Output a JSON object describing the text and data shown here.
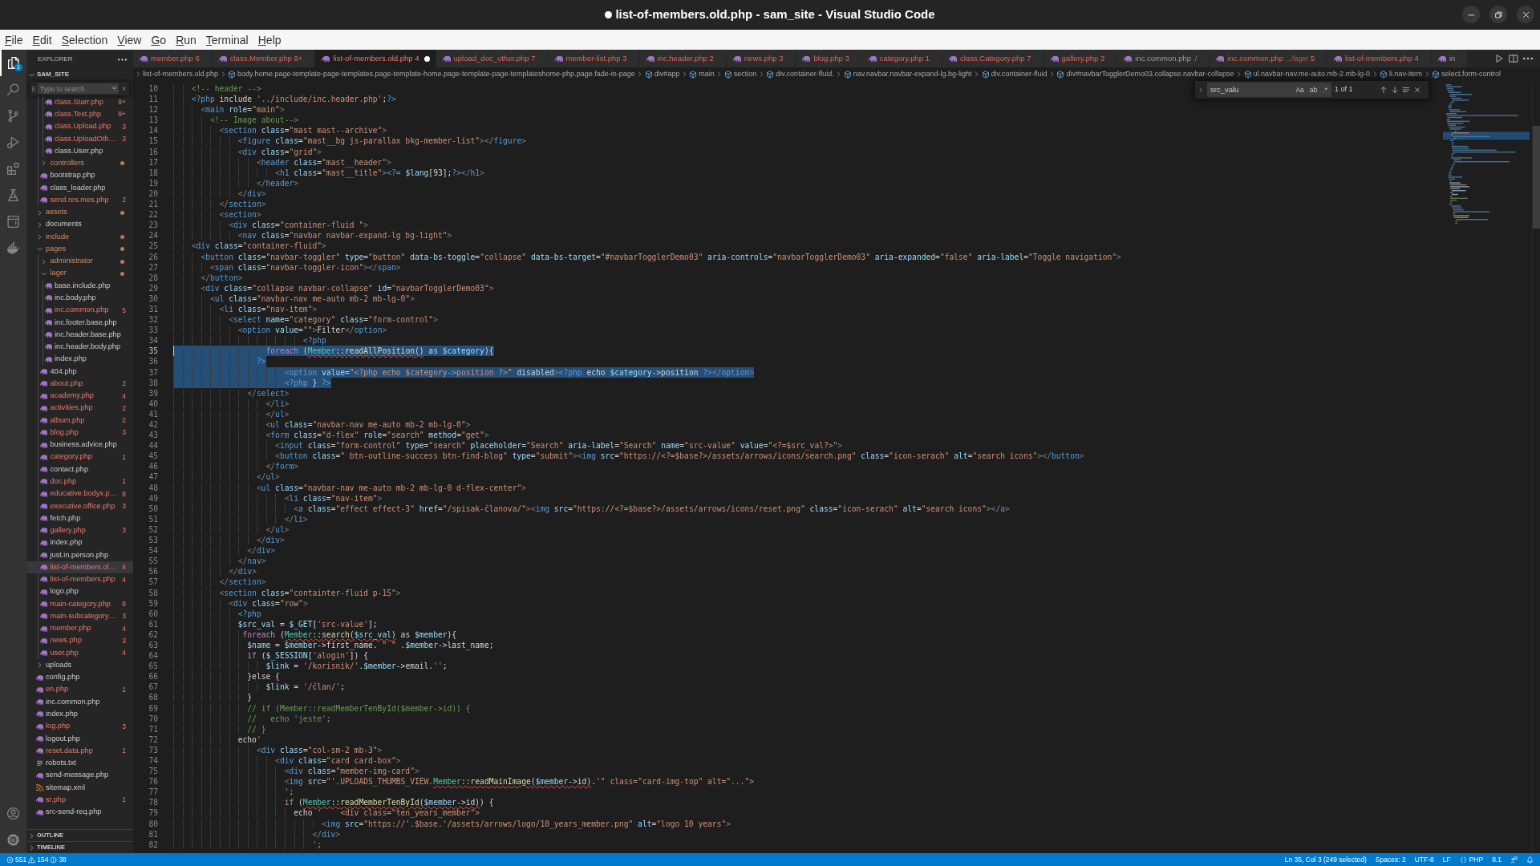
{
  "window": {
    "title": "list-of-members.old.php - sam_site - Visual Studio Code",
    "modified": true
  },
  "menu": [
    "File",
    "Edit",
    "Selection",
    "View",
    "Go",
    "Run",
    "Terminal",
    "Help"
  ],
  "activity_bar": {
    "items": [
      {
        "kind": "explorer",
        "selected": true,
        "badge": "1"
      },
      {
        "kind": "search",
        "selected": false
      },
      {
        "kind": "source-control",
        "selected": false
      },
      {
        "kind": "run-debug",
        "selected": false
      },
      {
        "kind": "extensions",
        "selected": false
      },
      {
        "kind": "testing",
        "selected": false
      },
      {
        "kind": "remote",
        "selected": false
      },
      {
        "kind": "docker",
        "selected": false
      }
    ],
    "bottom": [
      {
        "kind": "account"
      },
      {
        "kind": "settings"
      }
    ]
  },
  "sidebar": {
    "title": "EXPLORER",
    "section": {
      "title": "SAM_SITE",
      "expanded": true
    },
    "filter": {
      "placeholder": "Type to search"
    },
    "tree": [
      {
        "children": [
          {
            "children": [
              {
                "label": "class.Starr.php",
                "kind": "php",
                "error": true,
                "problems": "9+",
                "selected": false
              },
              {
                "label": "class.Text.php",
                "kind": "php",
                "error": true,
                "problems": "9+",
                "selected": false
              },
              {
                "label": "class.Upload.php",
                "kind": "php",
                "error": true,
                "problems": "3",
                "selected": false
              },
              {
                "label": "class.UploadOth…",
                "kind": "php",
                "error": true,
                "problems": "3",
                "selected": false
              },
              {
                "label": "class.User.php",
                "kind": "php",
                "error": false,
                "selected": false
              }
            ]
          },
          {
            "label": "controllers",
            "kind": "folder",
            "expanded": false,
            "error": true,
            "selected": false
          },
          {
            "label": "bootstrap.php",
            "kind": "php",
            "error": false,
            "selected": false
          },
          {
            "label": "class_loader.php",
            "kind": "php",
            "error": false,
            "selected": false
          },
          {
            "label": "send.res.mes.php",
            "kind": "php",
            "error": true,
            "problems": "2",
            "selected": false
          }
        ]
      },
      {
        "label": "assets",
        "kind": "folder",
        "expanded": false,
        "error": true,
        "selected": false
      },
      {
        "label": "documents",
        "kind": "folder",
        "expanded": false,
        "error": false,
        "selected": false
      },
      {
        "label": "include",
        "kind": "folder",
        "expanded": false,
        "error": true,
        "selected": false
      },
      {
        "label": "pages",
        "kind": "folder",
        "expanded": true,
        "error": true,
        "selected": false,
        "children": [
          {
            "label": "administrator",
            "kind": "folder",
            "expanded": false,
            "error": true,
            "selected": false
          },
          {
            "label": "lager",
            "kind": "folder",
            "expanded": true,
            "error": true,
            "selected": false,
            "children": [
              {
                "label": "base.include.php",
                "kind": "php",
                "error": false,
                "selected": false
              },
              {
                "label": "inc.body.php",
                "kind": "php",
                "error": false,
                "selected": false
              },
              {
                "label": "inc.common.php",
                "kind": "php",
                "error": true,
                "problems": "5",
                "selected": false
              },
              {
                "label": "inc.footer.base.php",
                "kind": "php",
                "error": false,
                "selected": false
              },
              {
                "label": "inc.header.base.php",
                "kind": "php",
                "error": false,
                "selected": false
              },
              {
                "label": "inc.header.body.php",
                "kind": "php",
                "error": false,
                "selected": false
              },
              {
                "label": "index.php",
                "kind": "php",
                "error": false,
                "selected": false
              }
            ]
          },
          {
            "label": "404.php",
            "kind": "php",
            "error": false,
            "selected": false
          },
          {
            "label": "about.php",
            "kind": "php",
            "error": true,
            "problems": "2",
            "selected": false
          },
          {
            "label": "academy.php",
            "kind": "php",
            "error": true,
            "problems": "4",
            "selected": false
          },
          {
            "label": "activities.php",
            "kind": "php",
            "error": true,
            "problems": "2",
            "selected": false
          },
          {
            "label": "album.php",
            "kind": "php",
            "error": true,
            "problems": "2",
            "selected": false
          },
          {
            "label": "blog.php",
            "kind": "php",
            "error": true,
            "problems": "3",
            "selected": false
          },
          {
            "label": "business.advice.php",
            "kind": "php",
            "error": false,
            "selected": false
          },
          {
            "label": "category.php",
            "kind": "php",
            "error": true,
            "problems": "1",
            "selected": false
          },
          {
            "label": "contact.php",
            "kind": "php",
            "error": false,
            "selected": false
          },
          {
            "label": "doc.php",
            "kind": "php",
            "error": true,
            "problems": "1",
            "selected": false
          },
          {
            "label": "educative.bodys.p…",
            "kind": "php",
            "error": true,
            "problems": "8",
            "selected": false
          },
          {
            "label": "executive.office.php",
            "kind": "php",
            "error": true,
            "problems": "3",
            "selected": false
          },
          {
            "label": "fetch.php",
            "kind": "php",
            "error": false,
            "selected": false
          },
          {
            "label": "gallery.php",
            "kind": "php",
            "error": true,
            "problems": "3",
            "selected": false
          },
          {
            "label": "index.php",
            "kind": "php",
            "error": false,
            "selected": false
          },
          {
            "label": "just.in.person.php",
            "kind": "php",
            "error": false,
            "selected": false
          },
          {
            "label": "list-of-members.ol…",
            "kind": "php",
            "error": true,
            "problems": "4",
            "selected": true
          },
          {
            "label": "list-of-members.php",
            "kind": "php",
            "error": true,
            "problems": "4",
            "selected": false
          },
          {
            "label": "logo.php",
            "kind": "php",
            "error": false,
            "selected": false
          },
          {
            "label": "main-category.php",
            "kind": "php",
            "error": true,
            "problems": "8",
            "selected": false
          },
          {
            "label": "main-subcategory…",
            "kind": "php",
            "error": true,
            "problems": "3",
            "selected": false
          },
          {
            "label": "member.php",
            "kind": "php",
            "error": true,
            "problems": "4",
            "selected": false
          },
          {
            "label": "news.php",
            "kind": "php",
            "error": true,
            "problems": "3",
            "selected": false
          },
          {
            "label": "user.php",
            "kind": "php",
            "error": true,
            "problems": "4",
            "selected": false
          }
        ]
      },
      {
        "label": "uploads",
        "kind": "folder",
        "expanded": false,
        "error": false,
        "selected": false
      },
      {
        "label": "config.php",
        "kind": "php",
        "error": false,
        "selected": false
      },
      {
        "label": "en.php",
        "kind": "php",
        "error": true,
        "problems": "1",
        "selected": false
      },
      {
        "label": "inc.common.php",
        "kind": "php",
        "error": false,
        "selected": false
      },
      {
        "label": "index.php",
        "kind": "php",
        "error": false,
        "selected": false
      },
      {
        "label": "log.php",
        "kind": "php",
        "error": true,
        "problems": "3",
        "selected": false
      },
      {
        "label": "logout.php",
        "kind": "php",
        "error": false,
        "selected": false
      },
      {
        "label": "reset.data.php",
        "kind": "php",
        "error": true,
        "problems": "1",
        "selected": false
      },
      {
        "label": "robots.txt",
        "kind": "txt",
        "error": false,
        "selected": false
      },
      {
        "label": "send-message.php",
        "kind": "php",
        "error": false,
        "selected": false
      },
      {
        "label": "sitemap.xml",
        "kind": "xml",
        "error": false,
        "selected": false
      },
      {
        "label": "sr.php",
        "kind": "php",
        "error": true,
        "problems": "1",
        "selected": false
      },
      {
        "label": "src-send-req.php",
        "kind": "php",
        "error": false,
        "selected": false
      }
    ],
    "panels": [
      {
        "title": "OUTLINE",
        "expanded": false
      },
      {
        "title": "TIMELINE",
        "expanded": false
      }
    ]
  },
  "editor": {
    "tabs": [
      {
        "label": "member.php",
        "problems": "6",
        "error": true,
        "selected": false,
        "modified": false
      },
      {
        "label": "class.Member.php",
        "problems": "9+",
        "error": true,
        "selected": false,
        "modified": false
      },
      {
        "label": "list-of-members.old.php",
        "problems": "4",
        "error": true,
        "selected": true,
        "modified": true
      },
      {
        "label": "upload_doc_other.php",
        "problems": "7",
        "error": true,
        "selected": false,
        "modified": false
      },
      {
        "label": "member-list.php",
        "problems": "3",
        "error": true,
        "selected": false,
        "modified": false
      },
      {
        "label": "inc.header.php",
        "problems": "2",
        "error": true,
        "selected": false,
        "modified": false
      },
      {
        "label": "news.php",
        "problems": "3",
        "error": true,
        "selected": false,
        "modified": false
      },
      {
        "label": "blog.php",
        "problems": "3",
        "error": true,
        "selected": false,
        "modified": false
      },
      {
        "label": "category.php",
        "problems": "1",
        "error": true,
        "selected": false,
        "modified": false
      },
      {
        "label": "class.Category.php",
        "problems": "7",
        "error": true,
        "selected": false,
        "modified": false
      },
      {
        "label": "gallery.php",
        "problems": "3",
        "error": true,
        "selected": false,
        "modified": false
      },
      {
        "label": "inc.common.php",
        "description": "./",
        "error": false,
        "selected": false,
        "modified": false
      },
      {
        "label": "inc.common.php",
        "description": ".../lager",
        "problems": "5",
        "error": true,
        "selected": false,
        "modified": false
      },
      {
        "label": "list-of-members.php",
        "problems": "4",
        "error": true,
        "selected": false,
        "modified": false
      },
      {
        "label": "in",
        "error": false,
        "selected": false,
        "modified": false
      }
    ],
    "breadcrumbs": [
      {
        "label": "list-of-members.old.php",
        "kind": "file"
      },
      {
        "label": "body.home.page-template-page-templates.page-template-home.page-template-page-templateshome-php.page.fade-in-page",
        "kind": "symbol"
      },
      {
        "label": "div#app",
        "kind": "symbol"
      },
      {
        "label": "main",
        "kind": "symbol"
      },
      {
        "label": "section",
        "kind": "symbol"
      },
      {
        "label": "div.container-fluid.",
        "kind": "symbol"
      },
      {
        "label": "nav.navbar.navbar-expand-lg.bg-light",
        "kind": "symbol"
      },
      {
        "label": "div.container-fluid",
        "kind": "symbol"
      },
      {
        "label": "div#navbarTogglerDemo03.collapse.navbar-collapse",
        "kind": "symbol"
      },
      {
        "label": "ul.navbar-nav.me-auto.mb-2.mb-lg-0",
        "kind": "symbol"
      },
      {
        "label": "li.nav-item",
        "kind": "symbol"
      },
      {
        "label": "select.form-control",
        "kind": "symbol"
      }
    ],
    "find": {
      "replace_expanded": false,
      "query": "src_valu",
      "options": [
        {
          "label": "Aa",
          "on": false
        },
        {
          "label": "ab",
          "on": false
        },
        {
          "label": ".*",
          "on": false
        }
      ],
      "result": "1 of 1"
    },
    "lines": [
      {
        "number": "10",
        "text": "    <!-- header -->"
      },
      {
        "number": "11",
        "text": "    <?php include '../include/inc.header.php';?>"
      },
      {
        "number": "12",
        "text": "      <main role=\"main\">"
      },
      {
        "number": "13",
        "text": "        <!-- Image about-->"
      },
      {
        "number": "14",
        "text": "          <section class=\"mast mast--archive\">"
      },
      {
        "number": "15",
        "text": "              <figure class=\"mast__bg js-parallax bkg-member-list\"></figure>"
      },
      {
        "number": "16",
        "text": "              <div class=\"grid\">"
      },
      {
        "number": "17",
        "text": "                  <header class=\"mast__header\">"
      },
      {
        "number": "18",
        "text": "                      <h1 class=\"mast__title\"><?= $lang[93];?></h1>"
      },
      {
        "number": "19",
        "text": "                  </header>"
      },
      {
        "number": "20",
        "text": "              </div>"
      },
      {
        "number": "21",
        "text": "          </section>"
      },
      {
        "number": "22",
        "text": "          <section>"
      },
      {
        "number": "23",
        "text": "            <div class=\"container-fluid \">"
      },
      {
        "number": "24",
        "text": "              <nav class=\"navbar navbar-expand-lg bg-light\">"
      },
      {
        "number": "25",
        "text": "    <div class=\"container-fluid\">"
      },
      {
        "number": "26",
        "text": "      <button class=\"navbar-toggler\" type=\"button\" data-bs-toggle=\"collapse\" data-bs-target=\"#navbarTogglerDemo03\" aria-controls=\"navbarTogglerDemo03\" aria-expanded=\"false\" aria-label=\"Toggle navigation\">"
      },
      {
        "number": "27",
        "text": "        <span class=\"navbar-toggler-icon\"></span>"
      },
      {
        "number": "28",
        "text": "      </button>"
      },
      {
        "number": "29",
        "text": "      <div class=\"collapse navbar-collapse\" id=\"navbarTogglerDemo03\">"
      },
      {
        "number": "30",
        "text": "        <ul class=\"navbar-nav me-auto mb-2 mb-lg-0\">"
      },
      {
        "number": "31",
        "text": "          <li class=\"nav-item\">"
      },
      {
        "number": "32",
        "text": "            <select name=\"category\" class=\"form-control\">"
      },
      {
        "number": "33",
        "text": "              <option value=\"\">Filter</option>"
      },
      {
        "number": "34",
        "text": "                            <?php"
      },
      {
        "number": "35",
        "segments": [
          {
            "text": "                    foreach (",
            "selected": true,
            "error": false,
            "caret": true
          },
          {
            "text": "Member::readAllPosition()",
            "selected": true,
            "error": true,
            "caret": false
          },
          {
            "text": " as $category){",
            "selected": true,
            "error": false,
            "caret": false
          }
        ]
      },
      {
        "number": "36",
        "segments": [
          {
            "text": "                  ?>",
            "selected": true,
            "error": false,
            "caret": false
          }
        ]
      },
      {
        "number": "37",
        "segments": [
          {
            "text": "                        <option value=\"<?php echo $category->position ?>\" disabled><?php echo $category->position ?></option>",
            "selected": true,
            "error": false,
            "caret": false
          }
        ]
      },
      {
        "number": "38",
        "segments": [
          {
            "text": "                        <?php } ?>",
            "selected": true,
            "error": false,
            "caret": false
          }
        ]
      },
      {
        "number": "39",
        "text": "                </select>"
      },
      {
        "number": "40",
        "text": "                    </li>"
      },
      {
        "number": "41",
        "text": "                    </ul>"
      },
      {
        "number": "42",
        "text": "                    <ul class=\"navbar-nav me-auto mb-2 mb-lg-0\">"
      },
      {
        "number": "43",
        "text": "                    <form class=\"d-flex\" role=\"search\" method=\"get\">"
      },
      {
        "number": "44",
        "text": "                      <input class=\"form-control\" type=\"search\" placeholder=\"Search\" aria-label=\"Search\" name=\"src-value\" value=\"<?=$src_val?>\">"
      },
      {
        "number": "45",
        "text": "                      <button class=\" btn-outline-success btn-find-blog\" type=\"submit\"><img src=\"https://<?=$base?>/assets/arrows/icons/search.png\" class=\"icon-serach\" alt=\"search icons\"></button>"
      },
      {
        "number": "46",
        "text": "                    </form>"
      },
      {
        "number": "47",
        "text": "                  </ul>"
      },
      {
        "number": "48",
        "text": "                  <ul class=\"navbar-nav me-auto mb-2 mb-lg-0 d-flex-center\">"
      },
      {
        "number": "49",
        "text": "                        <li class=\"nav-item\">"
      },
      {
        "number": "50",
        "text": "                          <a class=\"effect effect-3\" href=\"/spisak-članova/\"><img src=\"https://<?=$base?>/assets/arrows/icons/reset.png\" class=\"icon-serach\" alt=\"search icons\"></a>"
      },
      {
        "number": "51",
        "text": "                        </li>"
      },
      {
        "number": "52",
        "text": "                    </ul>"
      },
      {
        "number": "53",
        "text": "                  </div>"
      },
      {
        "number": "54",
        "text": "                </div>"
      },
      {
        "number": "55",
        "text": "              </nav>"
      },
      {
        "number": "56",
        "text": "            </div>"
      },
      {
        "number": "57",
        "text": "          </section>"
      },
      {
        "number": "58",
        "text": "          <section class=\"containter-fluid p-15\">"
      },
      {
        "number": "59",
        "text": "            <div class=\"row\">"
      },
      {
        "number": "60",
        "text": "              <?php"
      },
      {
        "number": "61",
        "text": "              $src_val = $_GET['src-value'];"
      },
      {
        "number": "62",
        "segments": [
          {
            "text": "               foreach (",
            "selected": false,
            "error": false,
            "caret": false
          },
          {
            "text": "Member::search($src_val)",
            "selected": false,
            "error": true,
            "caret": false
          },
          {
            "text": " as $member){",
            "selected": false,
            "error": false,
            "caret": false
          }
        ]
      },
      {
        "number": "63",
        "text": "                $name = $member->first_name. \" \" .$member->last_name;"
      },
      {
        "number": "64",
        "text": "                if ($_SESSION['alogin']) {"
      },
      {
        "number": "65",
        "text": "                    $link = '/korisnik/'.$member->email.'';"
      },
      {
        "number": "66",
        "text": "                }else {"
      },
      {
        "number": "67",
        "text": "                    $link = '/član/';"
      },
      {
        "number": "68",
        "text": "                }"
      },
      {
        "number": "69",
        "text": "                // if (Member::readMemberTenById($member->id)) {"
      },
      {
        "number": "70",
        "text": "                //   echo 'jeste';"
      },
      {
        "number": "71",
        "text": "                // }"
      },
      {
        "number": "72",
        "text": "              echo'"
      },
      {
        "number": "73",
        "text": "                  <div class=\"col-sm-2 mb-3\">"
      },
      {
        "number": "74",
        "text": "                      <div class=\"card card-box\">"
      },
      {
        "number": "75",
        "text": "                        <div class=\"member-img-card\">"
      },
      {
        "number": "76",
        "segments": [
          {
            "text": "                        <img src=\"'.UPLOADS_THUMBS_VIEW.",
            "selected": false,
            "error": false,
            "caret": false
          },
          {
            "text": "Member::readMainImage($member->id)",
            "selected": false,
            "error": true,
            "caret": false
          },
          {
            "text": ".'\" class=\"card-img-top\" alt=\"...\">",
            "selected": false,
            "error": false,
            "caret": false
          }
        ]
      },
      {
        "number": "77",
        "text": "                        ';"
      },
      {
        "number": "78",
        "segments": [
          {
            "text": "                        if (",
            "selected": false,
            "error": false,
            "caret": false
          },
          {
            "text": "Member::readMemberTenById($member->id)",
            "selected": false,
            "error": true,
            "caret": false
          },
          {
            "text": ") {",
            "selected": false,
            "error": false,
            "caret": false
          }
        ]
      },
      {
        "number": "79",
        "text": "                          echo '    <div class=\"ten_years_member\">"
      },
      {
        "number": "80",
        "text": "                                <img src=\"https://'.$base.'/assets/arrows/logo/10_years_member.png\" alt=\"logo 10 years\">"
      },
      {
        "number": "81",
        "text": "                              </div>"
      },
      {
        "number": "82",
        "text": "                              ';"
      }
    ]
  },
  "status_bar": {
    "problems": [
      {
        "kind": "error",
        "count": "551"
      },
      {
        "kind": "warning",
        "count": "154"
      },
      {
        "kind": "info",
        "count": "38"
      }
    ],
    "items": [
      {
        "kind": "position",
        "text": "Ln 35, Col 3 (249 selected)"
      },
      {
        "kind": "indentation",
        "text": "Spaces: 2"
      },
      {
        "kind": "encoding",
        "text": "UTF-8"
      },
      {
        "kind": "eol",
        "text": "LF"
      },
      {
        "kind": "language",
        "text": "PHP"
      },
      {
        "kind": "version",
        "text": "8.1"
      },
      {
        "kind": "feedback"
      },
      {
        "kind": "notifications"
      }
    ]
  }
}
